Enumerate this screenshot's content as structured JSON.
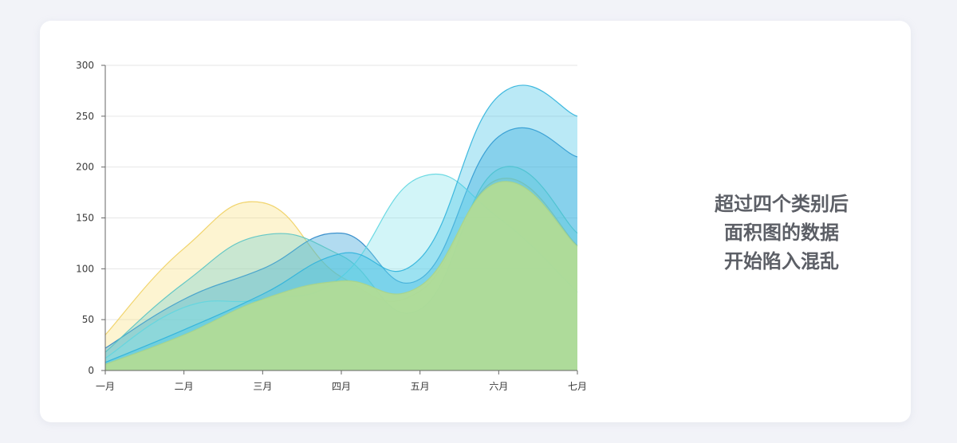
{
  "caption": {
    "line1": "超过四个类别后",
    "line2": "面积图的数据",
    "line3": "开始陷入混乱"
  },
  "chart_data": {
    "type": "area",
    "categories": [
      "一月",
      "二月",
      "三月",
      "四月",
      "五月",
      "六月",
      "七月"
    ],
    "ylim": [
      0,
      300
    ],
    "yticks": [
      0,
      50,
      100,
      150,
      200,
      250,
      300
    ],
    "grid": true,
    "series": [
      {
        "values": [
          35,
          120,
          165,
          92,
          78,
          188,
          123
        ],
        "fill": "#f9e07a",
        "stroke": "#f0d060"
      },
      {
        "values": [
          22,
          70,
          100,
          135,
          90,
          230,
          210
        ],
        "fill": "#1f97d4",
        "stroke": "#2c87c8"
      },
      {
        "values": [
          18,
          86,
          133,
          113,
          60,
          198,
          135
        ],
        "fill": "#66cfd0",
        "stroke": "#56c3c4"
      },
      {
        "values": [
          12,
          62,
          70,
          92,
          190,
          150,
          77
        ],
        "fill": "#7ee3ea",
        "stroke": "#5fd6e0"
      },
      {
        "values": [
          8,
          40,
          75,
          115,
          110,
          270,
          250
        ],
        "fill": "#38bfe4",
        "stroke": "#2fb3dc"
      },
      {
        "values": [
          6,
          35,
          70,
          88,
          83,
          185,
          122
        ],
        "fill": "#b3dc94",
        "stroke": "#a8d48a"
      }
    ]
  }
}
